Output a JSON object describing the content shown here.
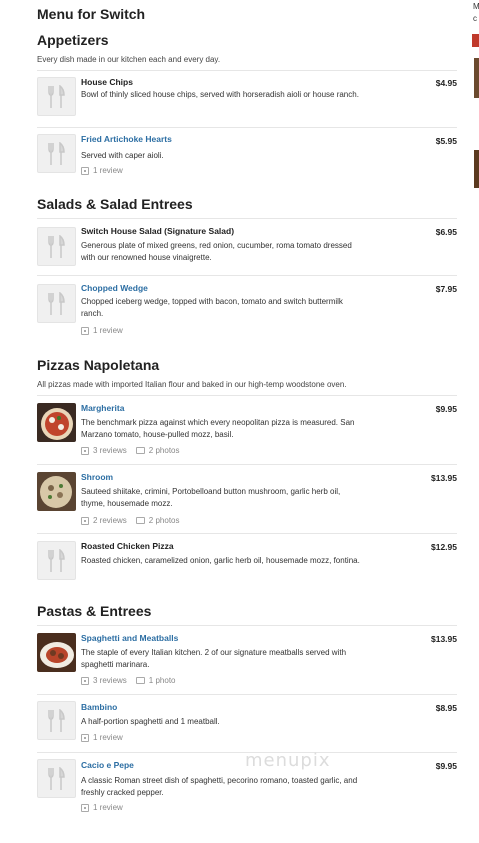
{
  "page_title": "Menu for Switch",
  "edge_text": [
    "M",
    "c"
  ],
  "sections": [
    {
      "title": "Appetizers",
      "description": "Every dish made in our kitchen each and every day.",
      "items": [
        {
          "name": "House Chips",
          "price": "$4.95",
          "description": "Bowl of thinly sliced house chips, served with horseradish aioli or house ranch."
        },
        {
          "name": "Fried Artichoke Hearts",
          "price": "$5.95",
          "description": "Served with caper aioli.",
          "reviews": "1 review"
        }
      ]
    },
    {
      "title": "Salads & Salad Entrees",
      "description": "",
      "items": [
        {
          "name": "Switch House Salad (Signature Salad)",
          "price": "$6.95",
          "description": "Generous plate of mixed greens, red onion, cucumber, roma tomato dressed with our renowned house vinaigrette."
        },
        {
          "name": "Chopped Wedge",
          "price": "$7.95",
          "description": "Chopped iceberg wedge, topped with bacon, tomato and switch buttermilk ranch.",
          "reviews": "1 review"
        }
      ]
    },
    {
      "title": "Pizzas Napoletana",
      "description": "All pizzas made with imported Italian flour and baked in our high-temp woodstone oven.",
      "items": [
        {
          "name": "Margherita",
          "price": "$9.95",
          "description": "The benchmark pizza against which every neopolitan pizza is measured. San Marzano tomato, house-pulled mozz, basil.",
          "reviews": "3 reviews",
          "photos": "2 photos"
        },
        {
          "name": "Shroom",
          "price": "$13.95",
          "description": "Sauteed shiitake, crimini, Portobelloand button mushroom, garlic herb oil, thyme, housemade mozz.",
          "reviews": "2 reviews",
          "photos": "2 photos"
        },
        {
          "name": "Roasted Chicken Pizza",
          "price": "$12.95",
          "description": "Roasted chicken, caramelized onion, garlic herb oil, housemade mozz, fontina."
        }
      ]
    },
    {
      "title": "Pastas & Entrees",
      "description": "",
      "items": [
        {
          "name": "Spaghetti and Meatballs",
          "price": "$13.95",
          "description": "The staple of every Italian kitchen. 2 of our signature meatballs served with spaghetti marinara.",
          "reviews": "3 reviews",
          "photos": "1 photo"
        },
        {
          "name": "Bambino",
          "price": "$8.95",
          "description": "A half-portion spaghetti and 1 meatball.",
          "reviews": "1 review"
        },
        {
          "name": "Cacio e Pepe",
          "price": "$9.95",
          "description": "A classic Roman street dish of spaghetti, pecorino romano, toasted garlic, and freshly cracked pepper.",
          "reviews": "1 review"
        }
      ]
    }
  ],
  "watermark": "menupix",
  "colors": {
    "link": "#2c6ea3",
    "text": "#222222",
    "muted": "#888888",
    "divider": "#e6e6e6"
  }
}
